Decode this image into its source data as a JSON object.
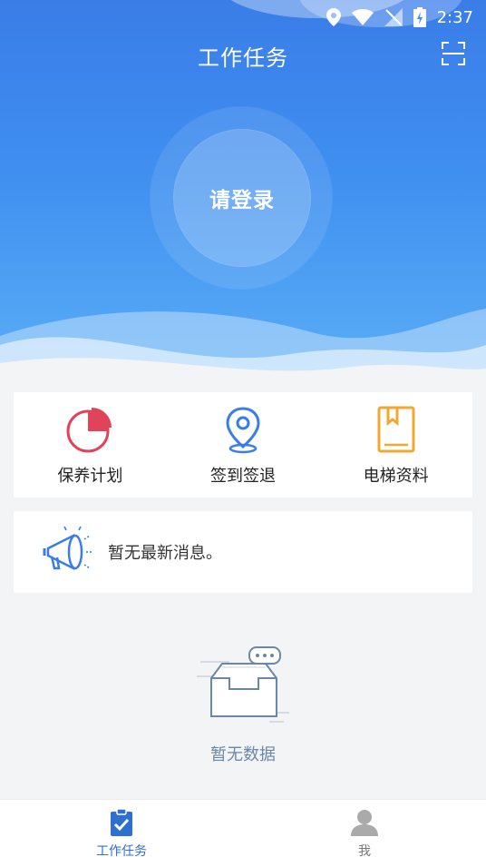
{
  "status": {
    "time": "2:37"
  },
  "header": {
    "title": "工作任务",
    "login_label": "请登录"
  },
  "features": [
    {
      "label": "保养计划",
      "icon": "pie-chart-icon",
      "color": "#e0435a"
    },
    {
      "label": "签到签退",
      "icon": "location-pin-icon",
      "color": "#3a7de8"
    },
    {
      "label": "电梯资料",
      "icon": "book-icon",
      "color": "#f0a830"
    }
  ],
  "message": {
    "text": "暂无最新消息。",
    "icon": "megaphone-icon"
  },
  "empty": {
    "text": "暂无数据",
    "icon": "empty-inbox-icon"
  },
  "tabs": [
    {
      "label": "工作任务",
      "icon": "clipboard-check-icon",
      "active": true
    },
    {
      "label": "我",
      "icon": "user-icon",
      "active": false
    }
  ],
  "colors": {
    "primary": "#3a7de8",
    "tab_active": "#2f6fce"
  }
}
